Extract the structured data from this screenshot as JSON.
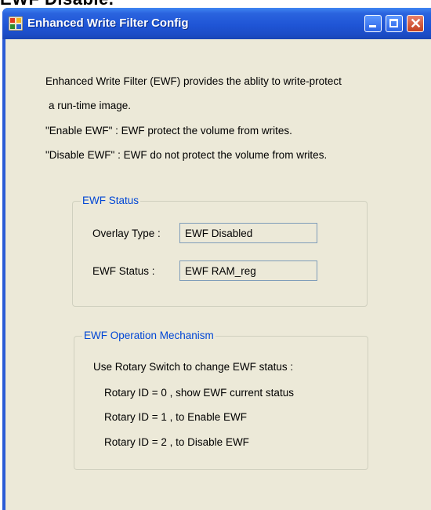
{
  "caption": "EWF Disable.",
  "window": {
    "title": "Enhanced Write Filter  Config",
    "minimize_icon": "minimize-icon",
    "maximize_icon": "maximize-icon",
    "close_icon": "close-icon",
    "close_glyph": "✕"
  },
  "intro": {
    "line1": "Enhanced Write Filter (EWF) provides the ablity to  write-protect",
    "line2": "a run-time image.",
    "line3": "\"Enable EWF\" : EWF protect the volume from writes.",
    "line4": "\"Disable EWF\" : EWF do not protect the volume from writes."
  },
  "status_group": {
    "legend": "EWF Status",
    "overlay_label": "Overlay Type :",
    "overlay_value": "EWF Disabled",
    "status_label": "EWF Status :",
    "status_value": "EWF RAM_reg"
  },
  "operation_group": {
    "legend": "EWF Operation Mechanism",
    "lines": [
      "Use Rotary Switch to change EWF status  :",
      "Rotary ID = 0 , show EWF current status",
      "Rotary ID = 1 , to Enable EWF",
      "Rotary ID = 2 , to Disable EWF"
    ]
  },
  "colors": {
    "titlebar": "#1f55d6",
    "client_background": "#ece9d8",
    "legend_text": "#0046d5",
    "field_border": "#7f9db9"
  }
}
